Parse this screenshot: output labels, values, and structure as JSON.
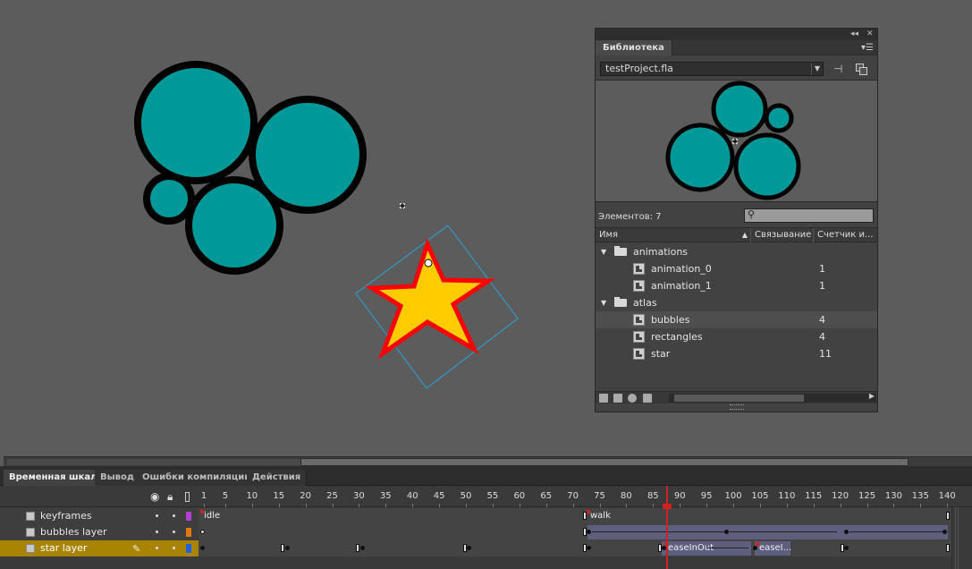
{
  "library": {
    "tab_label": "Библиотека",
    "file_select": "testProject.fla",
    "element_count_label": "Элементов: 7",
    "columns": {
      "name": "Имя",
      "linkage": "Связывание",
      "count": "Счетчик и..."
    },
    "rows": [
      {
        "type": "folder",
        "name": "animations",
        "count": ""
      },
      {
        "type": "symbol",
        "name": "animation_0",
        "count": "1"
      },
      {
        "type": "symbol",
        "name": "animation_1",
        "count": "1"
      },
      {
        "type": "folder",
        "name": "atlas",
        "count": ""
      },
      {
        "type": "symbol",
        "name": "bubbles",
        "count": "4",
        "selected": true
      },
      {
        "type": "symbol",
        "name": "rectangles",
        "count": "4"
      },
      {
        "type": "symbol",
        "name": "star",
        "count": "11"
      }
    ]
  },
  "timeline": {
    "tabs": [
      "Временная шкала",
      "Вывод",
      "Ошибки компиляции",
      "Действия"
    ],
    "ruler": [
      "1",
      "5",
      "10",
      "15",
      "20",
      "25",
      "30",
      "35",
      "40",
      "45",
      "50",
      "55",
      "60",
      "65",
      "70",
      "75",
      "80",
      "85",
      "90",
      "95",
      "100",
      "105",
      "110",
      "115",
      "120",
      "125",
      "130",
      "135",
      "140"
    ],
    "layers": [
      {
        "name": "keyframes",
        "color": "#b040d0"
      },
      {
        "name": "bubbles layer",
        "color": "#e07810"
      },
      {
        "name": "star layer",
        "color": "#2060e0",
        "selected": true
      }
    ],
    "frame_labels": {
      "idle": "idle",
      "walk": "walk",
      "ease1": "easeInOut",
      "ease2": "easeI..."
    },
    "current_frame": 88
  },
  "colors": {
    "bubble_fill": "#009999",
    "star_fill": "#ffcc00",
    "star_stroke": "#ff0000",
    "playhead": "#cc2222",
    "selected_layer": "#a88400"
  }
}
